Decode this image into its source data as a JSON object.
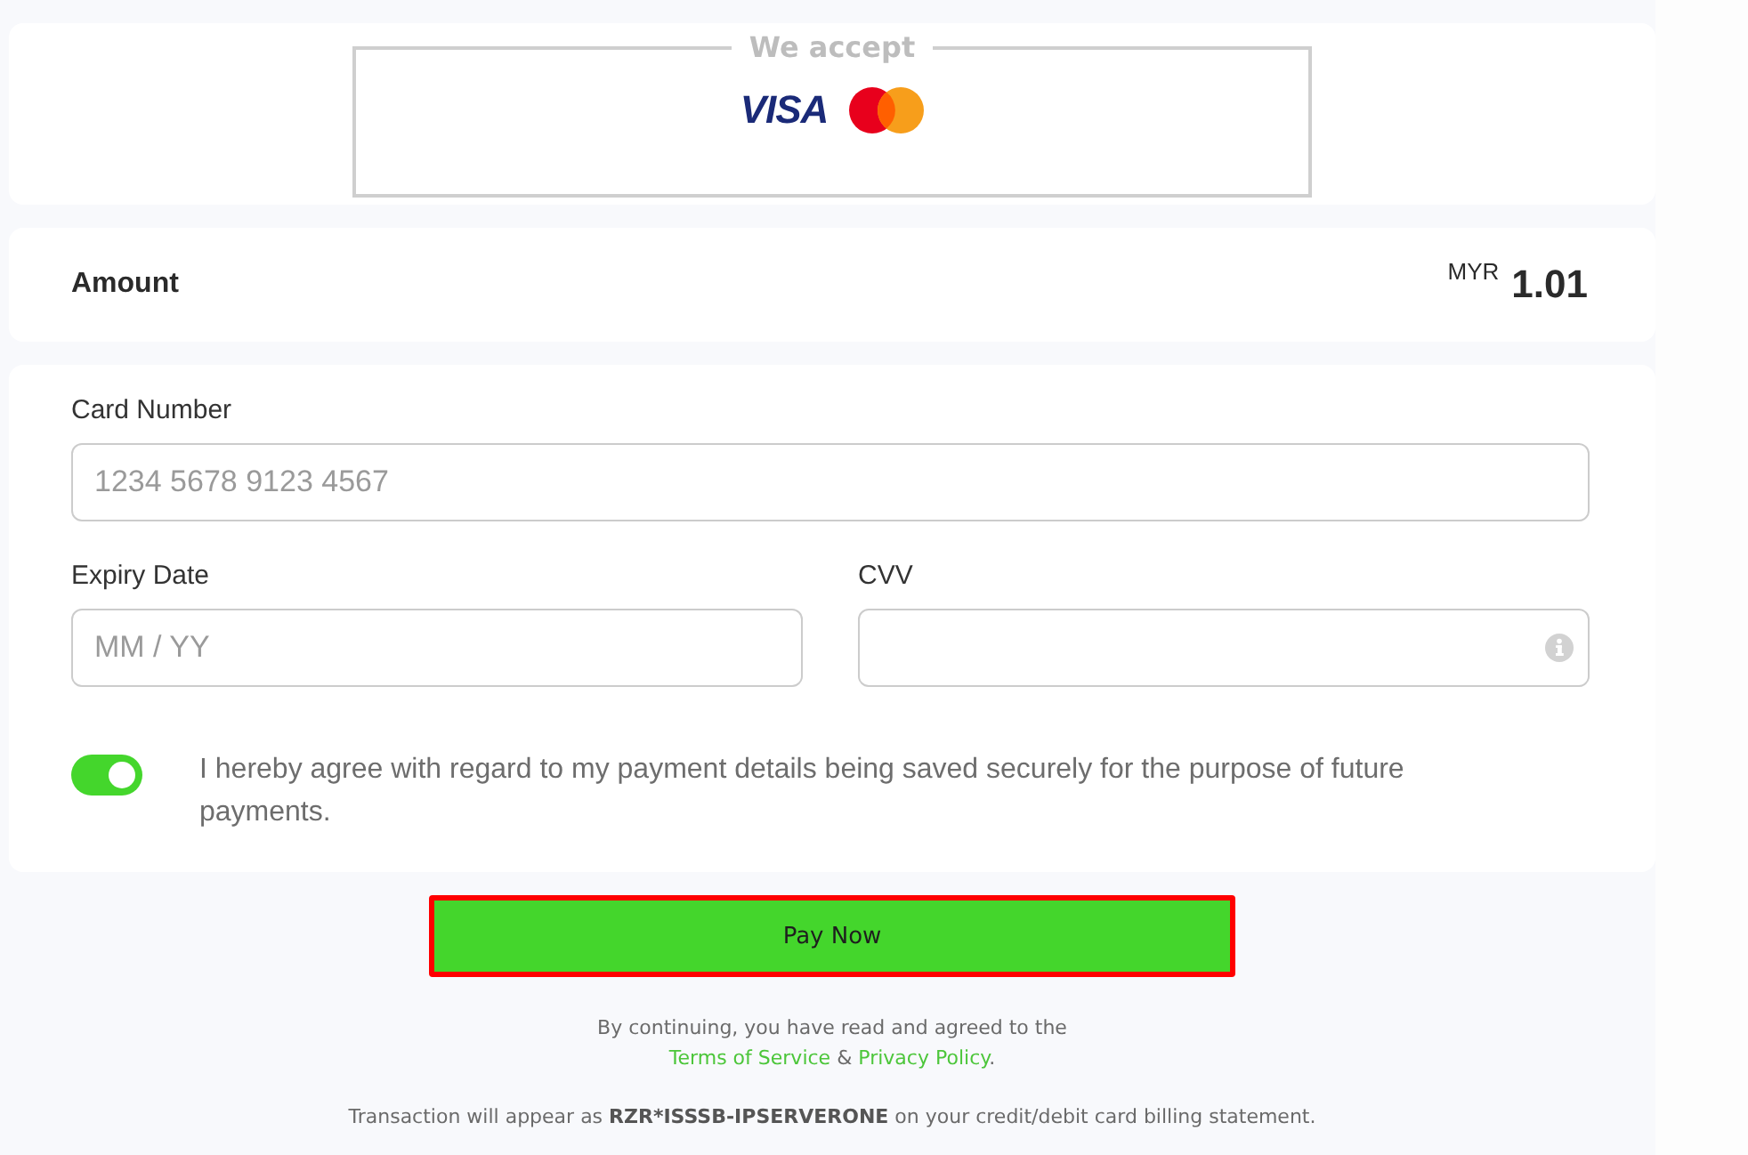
{
  "accept_panel": {
    "title": "We accept",
    "brands": [
      {
        "kind": "wordmark",
        "label": "VISA"
      },
      {
        "kind": "circles"
      }
    ]
  },
  "amount": {
    "label": "Amount",
    "currency": "MYR",
    "value": "1.01"
  },
  "card_number": {
    "label": "Card Number",
    "placeholder": "1234 5678 9123 4567"
  },
  "expiry_date": {
    "label": "Expiry Date",
    "placeholder": "MM / YY"
  },
  "cvv": {
    "label": "CVV"
  },
  "save_consent": {
    "on": true,
    "text": "I hereby agree with regard to my payment details being saved securely for the purpose of future payments."
  },
  "pay_button": {
    "label": "Pay Now"
  },
  "consent_notice": {
    "text": "By continuing, you have read and agreed to the",
    "links": [
      {
        "label": "Terms of Service"
      },
      {
        "label": "Privacy Policy"
      }
    ],
    "joiner": "&",
    "end": "."
  },
  "billing_notice": {
    "before": "Transaction will appear as",
    "descriptor": "RZR*ISSSB-IPSERVERONE",
    "after": "on your credit/debit card billing statement."
  }
}
